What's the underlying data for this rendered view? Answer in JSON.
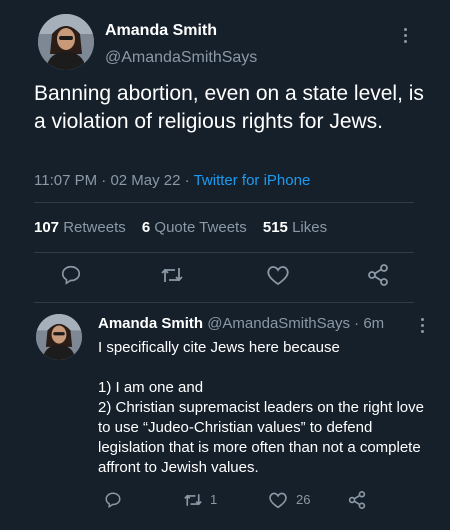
{
  "main_tweet": {
    "author_name": "Amanda Smith",
    "handle": "@AmandaSmithSays",
    "text": "Banning abortion, even on a state level, is a violation of religious rights for Jews.",
    "time": "11:07 PM",
    "date": "02 May 22",
    "source": "Twitter for iPhone",
    "stats": {
      "retweets_count": "107",
      "retweets_label": "Retweets",
      "quote_count": "6",
      "quote_label": "Quote Tweets",
      "likes_count": "515",
      "likes_label": "Likes"
    },
    "icons": [
      "reply-icon",
      "retweet-icon",
      "like-icon",
      "share-icon",
      "more-icon"
    ]
  },
  "reply_tweet": {
    "author_name": "Amanda Smith",
    "handle": "@AmandaSmithSays",
    "time_ago": "6m",
    "paragraphs": [
      "I specifically cite Jews here because",
      "1) I am one and\n2) Christian supremacist leaders on the right love to use “Judeo-Christian values” to defend legislation that is more often than not a complete affront to Jewish values."
    ],
    "retweet_count": "1",
    "like_count": "26"
  },
  "colors": {
    "background": "#15202b",
    "text": "#ffffff",
    "muted": "#8b98a5",
    "link": "#1d9bf0",
    "divider": "#2f3b47"
  }
}
